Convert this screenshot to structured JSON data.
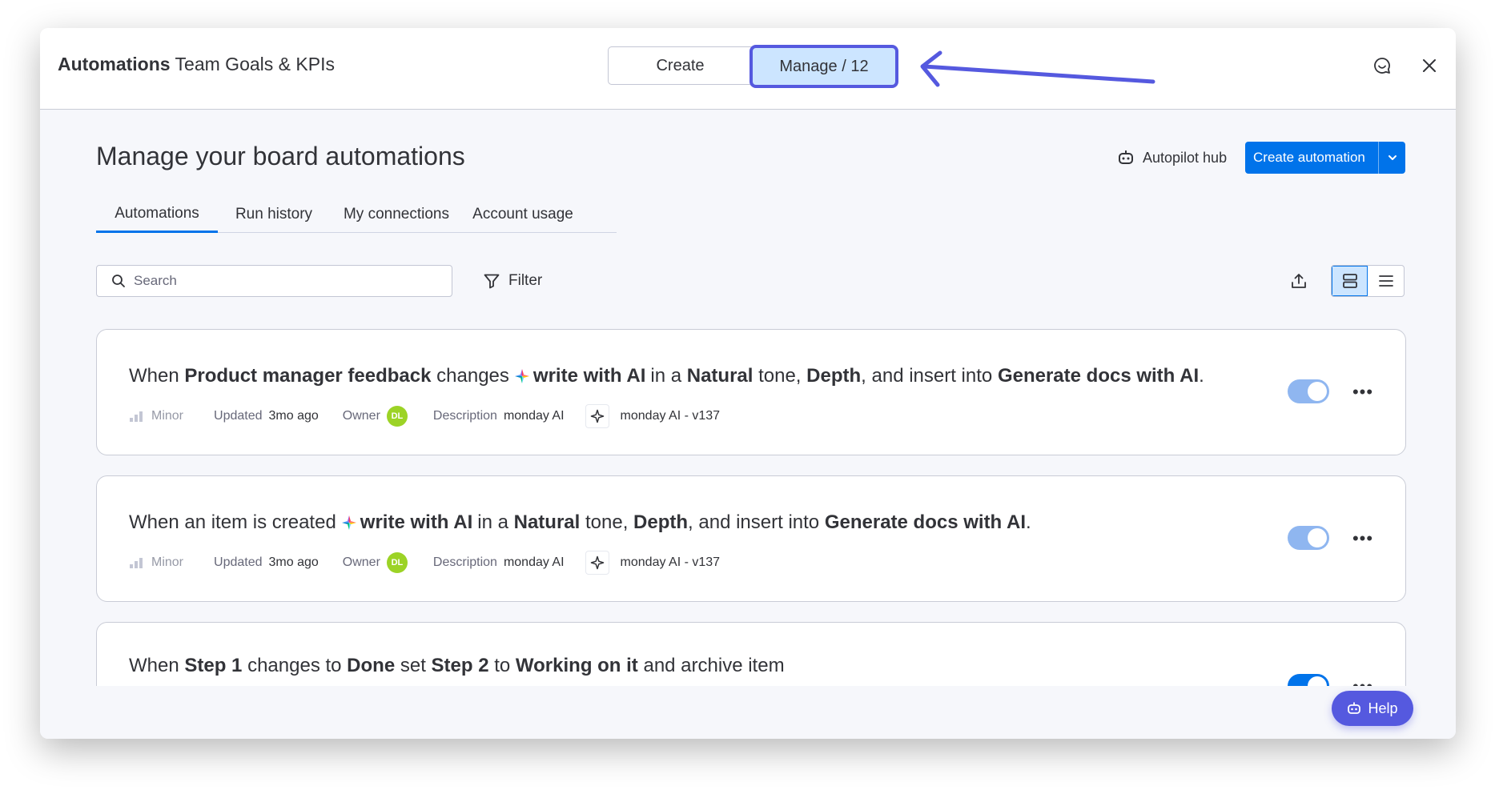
{
  "header": {
    "title_bold": "Automations",
    "title_rest": "Team Goals & KPIs",
    "segment_create": "Create",
    "segment_manage": "Manage / 12"
  },
  "main": {
    "title": "Manage your board automations",
    "autopilot_label": "Autopilot hub",
    "create_button_label": "Create automation",
    "tabs": [
      {
        "label": "Automations",
        "active": true
      },
      {
        "label": "Run history",
        "active": false
      },
      {
        "label": "My connections",
        "active": false
      },
      {
        "label": "Account usage",
        "active": false
      }
    ],
    "search": {
      "placeholder": "Search"
    },
    "filter_label": "Filter",
    "view_mode": "cards"
  },
  "automations": [
    {
      "rule": {
        "when": "When",
        "trigger_column": "Product manager feedback",
        "trigger_verb": "changes",
        "action": "write with AI",
        "in_a": "in a",
        "tone": "Natural",
        "tone_suffix": "tone,",
        "depth": "Depth",
        "insert_into": ", and insert into",
        "target": "Generate docs with AI",
        "end": "."
      },
      "meta": {
        "impact": "Minor",
        "updated_label": "Updated",
        "updated_value": "3mo ago",
        "owner_label": "Owner",
        "owner_initials": "DL",
        "description_label": "Description",
        "description_value": "monday AI",
        "version": "monday AI - v137"
      },
      "enabled": true
    },
    {
      "rule": {
        "trigger_text": "When an item is created",
        "action": "write with AI",
        "in_a": "in a",
        "tone": "Natural",
        "tone_suffix": "tone,",
        "depth": "Depth",
        "insert_into": ", and insert into",
        "target": "Generate docs with AI",
        "end": "."
      },
      "meta": {
        "impact": "Minor",
        "updated_label": "Updated",
        "updated_value": "3mo ago",
        "owner_label": "Owner",
        "owner_initials": "DL",
        "description_label": "Description",
        "description_value": "monday AI",
        "version": "monday AI - v137"
      },
      "enabled": true
    },
    {
      "rule": {
        "when": "When",
        "trigger_column": "Step 1",
        "changes_to": "changes to",
        "trigger_value": "Done",
        "set": "set",
        "target_column": "Step 2",
        "to": "to",
        "target_value": "Working on it",
        "tail": "and archive item"
      },
      "enabled": true
    }
  ],
  "help_label": "Help",
  "colors": {
    "primary": "#0073ea",
    "highlight": "#5559df",
    "selected_bg": "#cce5ff",
    "owner_avatar": "#9cd326"
  }
}
